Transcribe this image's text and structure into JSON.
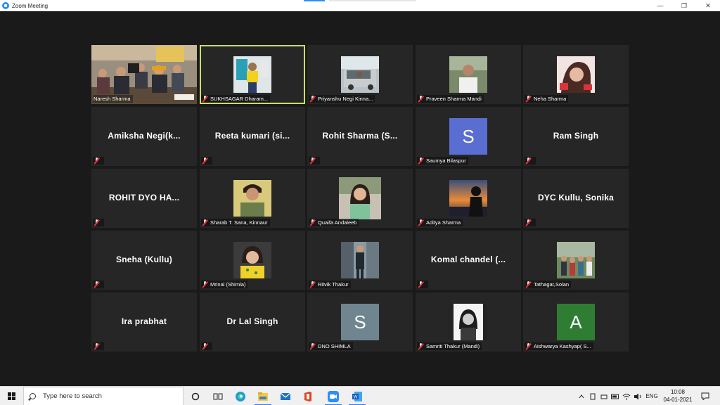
{
  "window": {
    "title": "Zoom Meeting",
    "controls": [
      "minimize",
      "restore",
      "close"
    ]
  },
  "meeting": {
    "active_speaker": "SUKHSAGAR Dharam...",
    "participants": [
      {
        "tile": "video",
        "label": "Naresh Sharma",
        "muted": false
      },
      {
        "tile": "video",
        "label": "SUKHSAGAR Dharam...",
        "muted": true,
        "active": true
      },
      {
        "tile": "video",
        "label": "Priyanshu Negi Kinna...",
        "muted": true
      },
      {
        "tile": "video",
        "label": "Praveen Sharma Mandi",
        "muted": true
      },
      {
        "tile": "video",
        "label": "Neha Sharma",
        "muted": true
      },
      {
        "tile": "name",
        "name": "Amiksha Negi(k...",
        "muted": true
      },
      {
        "tile": "name",
        "name": "Reeta kumari (si...",
        "muted": true
      },
      {
        "tile": "name",
        "name": "Rohit Sharma (S...",
        "muted": true
      },
      {
        "tile": "letter",
        "letter": "S",
        "letter_color": "#5a6dd0",
        "label": "Saumya Bilaspur",
        "muted": true
      },
      {
        "tile": "name",
        "name": "Ram Singh",
        "muted": true
      },
      {
        "tile": "name",
        "name": "ROHIT DYO HA...",
        "muted": true
      },
      {
        "tile": "video",
        "label": "Sharab T. Sana, Kinnaur",
        "muted": true
      },
      {
        "tile": "video",
        "label": "Quaifa Andaleeb",
        "muted": true
      },
      {
        "tile": "video",
        "label": "Aditya Sharma",
        "muted": true
      },
      {
        "tile": "name",
        "name": "DYC Kullu, Sonika",
        "muted": true
      },
      {
        "tile": "name",
        "name": "Sneha (Kullu)",
        "muted": true
      },
      {
        "tile": "video",
        "label": "Mrinal (Shimla)",
        "muted": true
      },
      {
        "tile": "video",
        "label": "Ritvik Thakur",
        "muted": true
      },
      {
        "tile": "name",
        "name": "Komal chandel (...",
        "muted": true
      },
      {
        "tile": "video",
        "label": "Tathagat,Solan",
        "muted": true
      },
      {
        "tile": "name",
        "name": "Ira prabhat",
        "muted": true
      },
      {
        "tile": "name",
        "name": "Dr Lal Singh",
        "muted": true
      },
      {
        "tile": "letter",
        "letter": "S",
        "letter_color": "#6f8590",
        "label": "DNO SHIMLA",
        "muted": true
      },
      {
        "tile": "video",
        "label": "Samriti Thakur (Mandi)",
        "muted": true
      },
      {
        "tile": "letter",
        "letter": "A",
        "letter_color": "#2e7d32",
        "label": "Aishwarya Kashyap( S...",
        "muted": true
      }
    ]
  },
  "taskbar": {
    "search_placeholder": "Type here to search",
    "pinned": [
      "task-view-icon",
      "edge-icon",
      "file-explorer-icon",
      "mail-icon",
      "office-icon",
      "zoom-icon",
      "word-icon"
    ],
    "language": "ENG",
    "time": "10:08",
    "date": "04-01-2021"
  }
}
